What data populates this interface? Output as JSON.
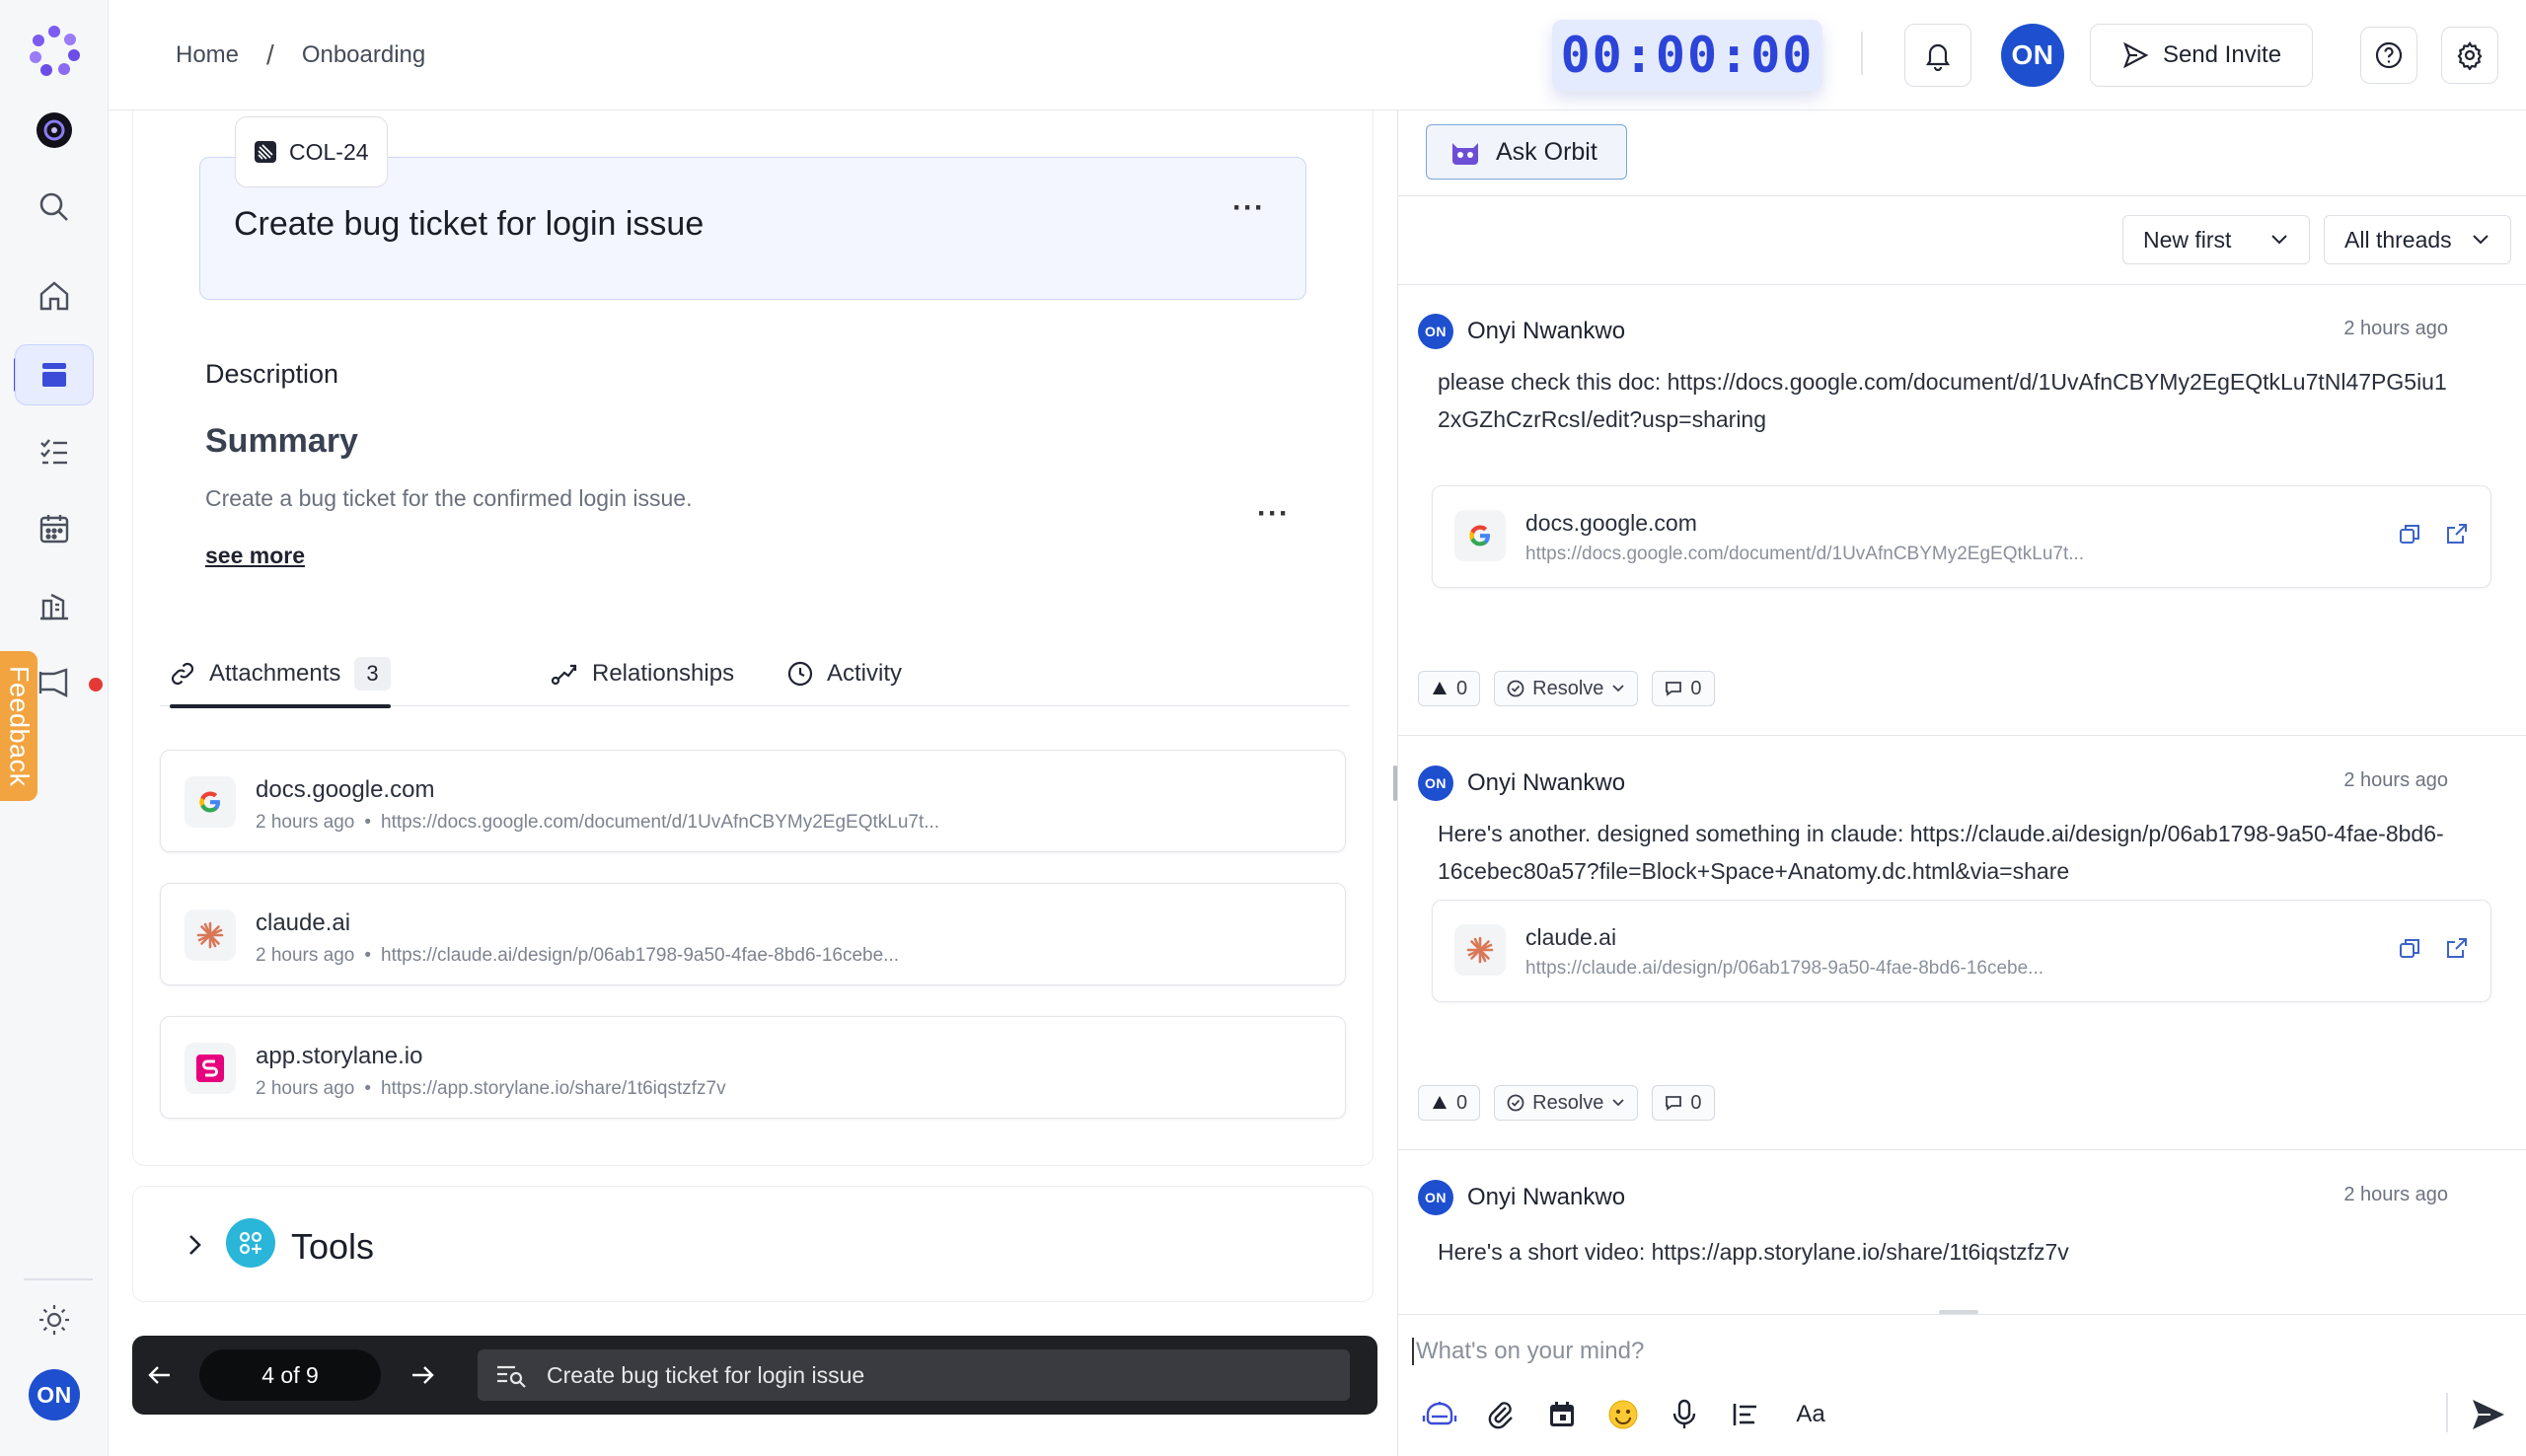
{
  "header": {
    "breadcrumb": [
      "Home",
      "Onboarding"
    ],
    "timer": "00:00:00",
    "avatar_initials": "ON",
    "send_invite_label": "Send Invite"
  },
  "rail": {
    "feedback_label": "Feedback",
    "user_initials": "ON",
    "icons": [
      "orbit-logo-icon",
      "workspace-icon",
      "search-icon",
      "home-icon",
      "board-icon",
      "tasks-icon",
      "calendar-icon",
      "analytics-icon",
      "announcements-icon",
      "theme-icon"
    ]
  },
  "ticket": {
    "id": "COL-24",
    "title": "Create bug ticket for login issue",
    "description_label": "Description",
    "summary_heading": "Summary",
    "summary_text": "Create a bug ticket for the confirmed login issue.",
    "see_more": "see more"
  },
  "tabs": [
    {
      "label": "Attachments",
      "count": "3",
      "active": true
    },
    {
      "label": "Relationships"
    },
    {
      "label": "Activity"
    }
  ],
  "attachments": [
    {
      "title": "docs.google.com",
      "time": "2 hours ago",
      "url": "https://docs.google.com/document/d/1UvAfnCBYMy2EgEQtkLu7t...",
      "icon": "google-icon"
    },
    {
      "title": "claude.ai",
      "time": "2 hours ago",
      "url": "https://claude.ai/design/p/06ab1798-9a50-4fae-8bd6-16cebe...",
      "icon": "claude-icon"
    },
    {
      "title": "app.storylane.io",
      "time": "2 hours ago",
      "url": "https://app.storylane.io/share/1t6iqstzfz7v",
      "icon": "storylane-icon"
    }
  ],
  "tools": {
    "title": "Tools"
  },
  "navigator": {
    "pager": "4 of 9",
    "current_title": "Create bug ticket for login issue"
  },
  "right": {
    "ask_orbit": "Ask Orbit",
    "sort_select": "New first",
    "filter_select": "All threads",
    "messages": [
      {
        "author": "Onyi Nwankwo",
        "initials": "ON",
        "time": "2 hours ago",
        "body": "please check this doc: https://docs.google.com/document/d/1UvAfnCBYMy2EgEQtkLu7tNl47PG5iu12xGZhCzrRcsI/edit?usp=sharing",
        "link_title": "docs.google.com",
        "link_url": "https://docs.google.com/document/d/1UvAfnCBYMy2EgEQtkLu7t...",
        "upvotes": "0",
        "resolve": "Resolve",
        "comments": "0"
      },
      {
        "author": "Onyi Nwankwo",
        "initials": "ON",
        "time": "2 hours ago",
        "body": "Here's another. designed something in claude: https://claude.ai/design/p/06ab1798-9a50-4fae-8bd6-16cebec80a57?file=Block+Space+Anatomy.dc.html&via=share",
        "link_title": "claude.ai",
        "link_url": "https://claude.ai/design/p/06ab1798-9a50-4fae-8bd6-16cebe...",
        "upvotes": "0",
        "resolve": "Resolve",
        "comments": "0"
      },
      {
        "author": "Onyi Nwankwo",
        "initials": "ON",
        "time": "2 hours ago",
        "body": "Here's a short video: https://app.storylane.io/share/1t6iqstzfz7v"
      }
    ],
    "composer_placeholder": "What's on your mind?",
    "composer_text_format": "Aa"
  }
}
